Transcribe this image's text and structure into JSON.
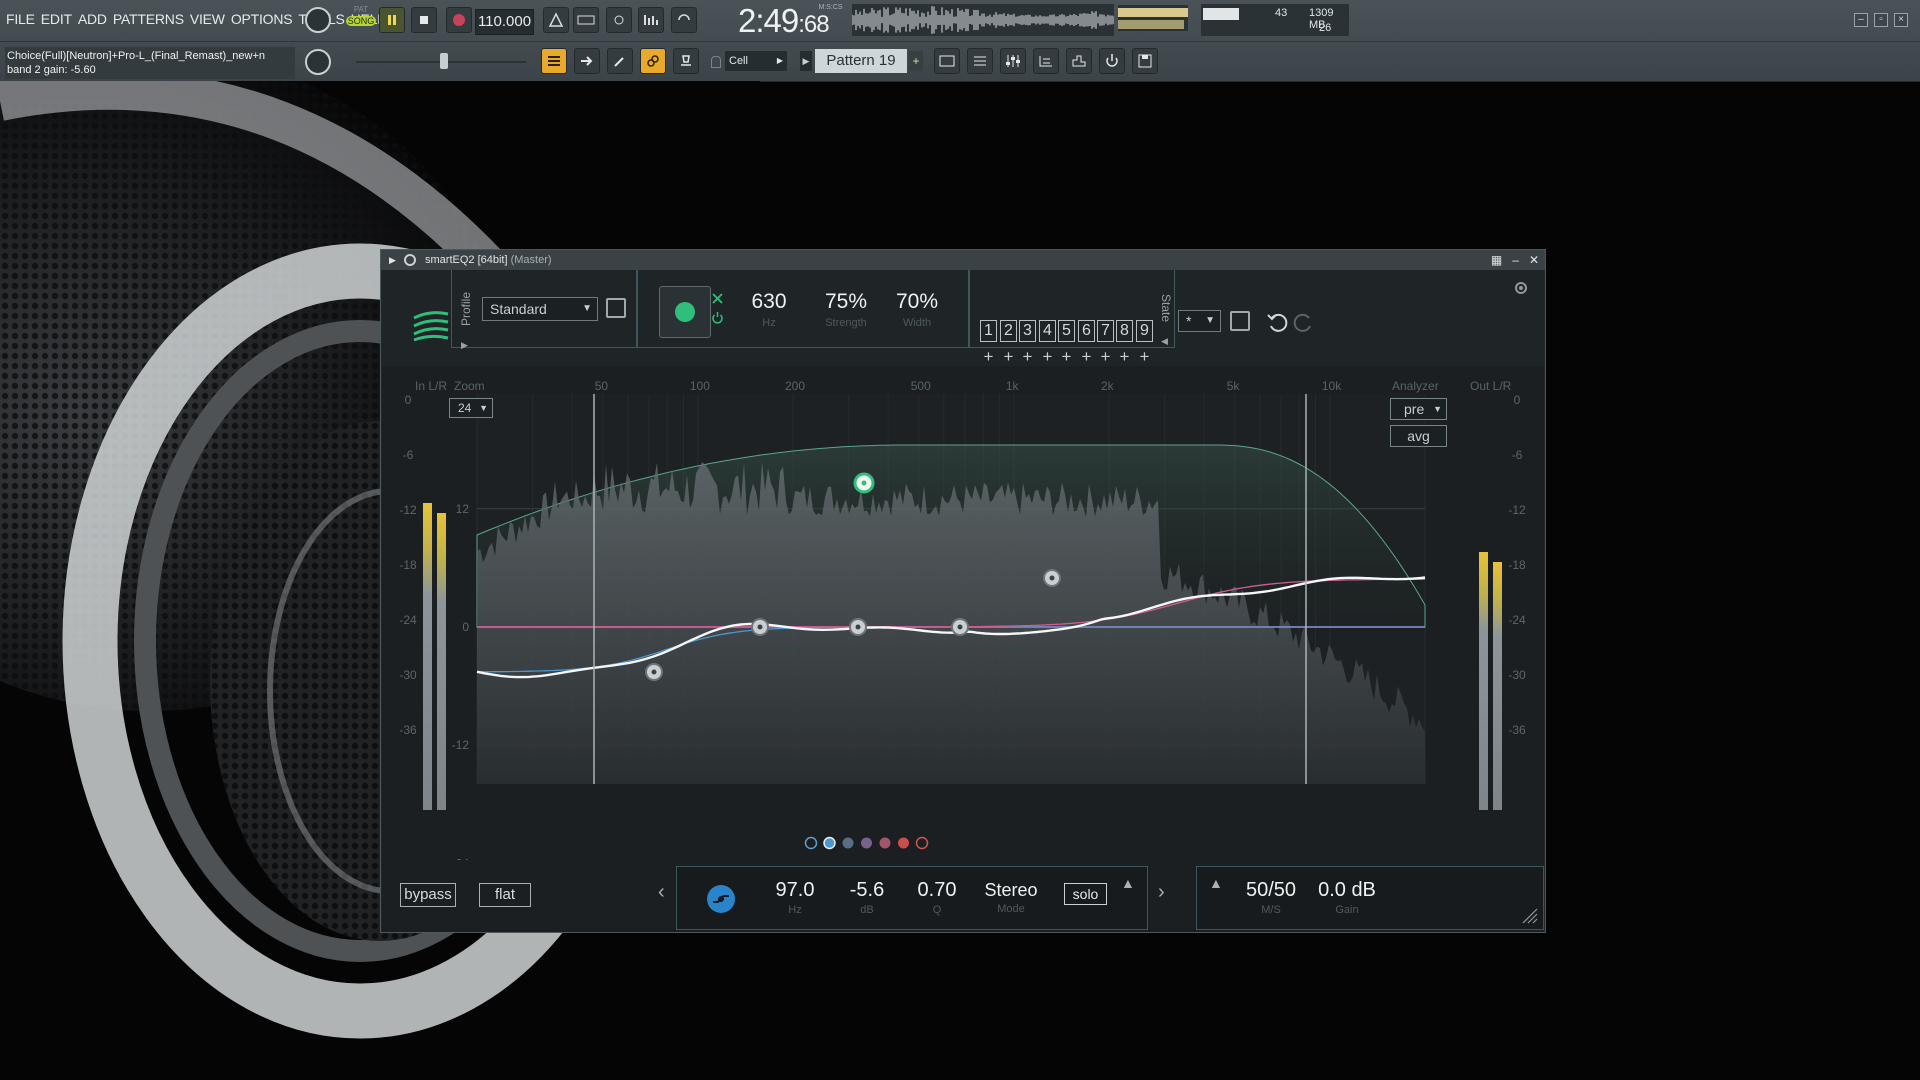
{
  "daw": {
    "menu": [
      "FILE",
      "EDIT",
      "ADD",
      "PATTERNS",
      "VIEW",
      "OPTIONS",
      "TOOLS",
      "HELP"
    ],
    "mode": {
      "pat": "PAT",
      "song": "SONG"
    },
    "tempo": "110.000",
    "time_main": "2:49",
    "time_sub": ":68",
    "time_label": "M:S:CS",
    "cpu_value": "43",
    "memory": "1309 MB",
    "polyphony": "26",
    "hint_line1": "Choice(Full)[Neutron]+Pro-L_(Final_Remast)_new+n",
    "hint_line2": "band 2 gain: -5.60",
    "snap": "Cell",
    "pattern": "Pattern 19",
    "window_controls": [
      "–",
      "▫",
      "×"
    ],
    "accent": "#f2b72c"
  },
  "plugin": {
    "title": "smartEQ2 [64bit]",
    "title_suffix": "(Master)",
    "profile_label": "Profile",
    "profile_value": "Standard",
    "frequency": "630",
    "frequency_unit": "Hz",
    "strength": "75%",
    "strength_label": "Strength",
    "width": "70%",
    "width_label": "Width",
    "state_label": "State",
    "state_slots": [
      "1",
      "2",
      "3",
      "4",
      "5",
      "6",
      "7",
      "8",
      "9"
    ],
    "state_select": "*",
    "in_label": "In L/R",
    "out_label": "Out L/R",
    "zoom_label": "Zoom",
    "zoom_value": "24",
    "analyzer_label": "Analyzer",
    "analyzer_mode": "pre",
    "avg_label": "avg",
    "freq_ticks": [
      "50",
      "100",
      "200",
      "500",
      "1k",
      "2k",
      "5k",
      "10k"
    ],
    "gain_ticks": [
      "12",
      "0",
      "-12",
      "-24"
    ],
    "meter_ticks": [
      "0",
      "-6",
      "-12",
      "-18",
      "-24",
      "-30",
      "-36"
    ],
    "bypass_label": "bypass",
    "flat_label": "flat",
    "band": {
      "freq": "97.0",
      "freq_unit": "Hz",
      "gain": "-5.6",
      "gain_unit": "dB",
      "q": "0.70",
      "q_label": "Q",
      "mode": "Stereo",
      "mode_label": "Mode",
      "solo_label": "solo"
    },
    "ms": {
      "value": "50/50",
      "label": "M/S",
      "gain": "0.0 dB",
      "gain_label": "Gain"
    },
    "band_dot_colors": [
      "#5e9fcf",
      "#4d98d1",
      "#596d86",
      "#77628f",
      "#a4556e",
      "#c94e4e",
      "#d1574e"
    ],
    "colors": {
      "accent_green": "#2fbf7a",
      "curve_pink": "#d05c92",
      "curve_blue": "#4d98d1",
      "curve_teal": "#5aa58a"
    }
  }
}
